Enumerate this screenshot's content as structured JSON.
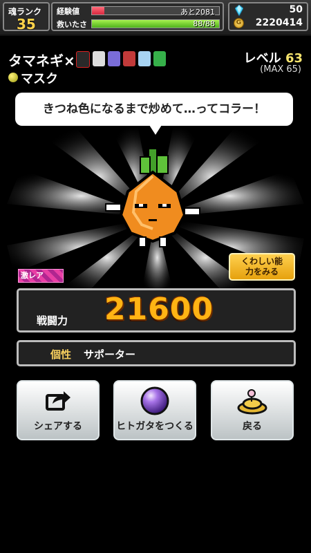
{
  "status": {
    "soul_rank_label": "魂ランク",
    "soul_rank_value": "35",
    "exp_label": "経験値",
    "exp_text": "あと2081",
    "exp_fill": 0.1,
    "rescue_label": "救いたさ",
    "rescue_text": "88/88",
    "rescue_fill": 1.0,
    "gems": "50",
    "coins": "2220414"
  },
  "character": {
    "name": "タマネギ×",
    "trait_name": "マスク",
    "level_label": "レベル",
    "level_value": "63",
    "level_max": "(MAX 65)",
    "speech": "きつね色になるまで炒めて…ってコラー！",
    "rarity": "激レア",
    "power_label": "戦闘力",
    "power_value": "21600",
    "personality_label": "個性",
    "personality_value": "サポーター"
  },
  "buttons": {
    "detail": "くわしい能力をみる",
    "share": "シェアする",
    "hitogata": "ヒトガタをつくる",
    "back": "戻る"
  },
  "colors": {
    "power_text": "#ffb414",
    "detail_button": "#ffd04f",
    "rarity_badge": "#e93fa5"
  }
}
